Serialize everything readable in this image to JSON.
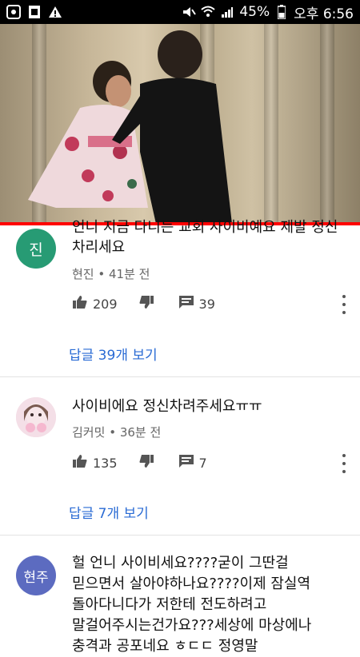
{
  "status_bar": {
    "battery": "45%",
    "time": "오후 6:56"
  },
  "video": {
    "progress_percent": 100,
    "progress_color": "#ff0000"
  },
  "comments": [
    {
      "avatar_text": "진",
      "avatar_color": "#279b74",
      "text_lines": [
        "언니 지금 다니는 교회 사이비예요 제발 정신",
        "차리세요"
      ],
      "author": "현진",
      "time": "41분 전",
      "likes": "209",
      "reply_count": "39",
      "replies_link": "답글 39개 보기"
    },
    {
      "avatar_text": "",
      "avatar_color": "#f2d6e2",
      "text_lines": [
        "사이비에요 정신차려주세요ㅠㅠ"
      ],
      "author": "김커밋",
      "time": "36분 전",
      "likes": "135",
      "reply_count": "7",
      "replies_link": "답글 7개 보기"
    },
    {
      "avatar_text": "현주",
      "avatar_color": "#5c6bc0",
      "text_lines": [
        "헐 언니 사이비세요????굳이 그딴걸",
        "믿으면서 살아야하나요????이제 잠실역",
        "돌아다니다가 저한테 전도하려고",
        "말걸어주시는건가요???세상에 마상에나",
        "충격과 공포네요 ㅎㄷㄷ 정영말"
      ]
    }
  ]
}
